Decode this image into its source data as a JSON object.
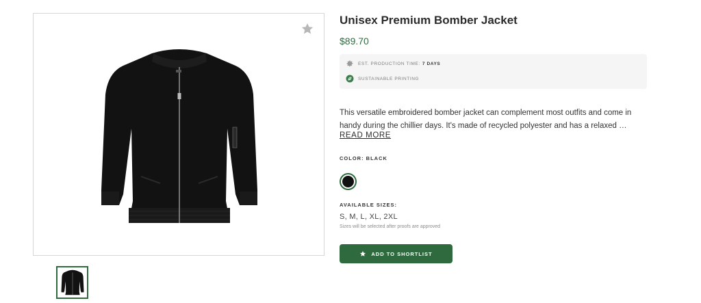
{
  "product": {
    "title": "Unisex Premium Bomber Jacket",
    "price": "$89.70",
    "description": "This versatile embroidered bomber jacket can complement most outfits and come in handy during the chillier days. It's made of recycled polyester and has a relaxed …",
    "read_more_label": "READ MORE"
  },
  "badges": {
    "production_label": "EST. PRODUCTION TIME:",
    "production_value": "7 DAYS",
    "production_icon": "gear-icon",
    "sustainable_label": "SUSTAINABLE PRINTING",
    "sustainable_icon": "leaf-icon"
  },
  "color": {
    "label": "COLOR: BLACK",
    "swatches": [
      {
        "name": "Black",
        "hex": "#111111",
        "selected": true
      }
    ]
  },
  "sizes": {
    "label": "AVAILABLE SIZES:",
    "values": "S, M, L, XL, 2XL",
    "note": "Sizes will be selected after proofs are approved"
  },
  "actions": {
    "add_to_shortlist_label": "ADD TO SHORTLIST",
    "favorite_icon": "star-icon"
  },
  "theme": {
    "accent": "#2f6a3e",
    "text": "#2c2c2c",
    "badge_bg": "#f5f5f5"
  }
}
